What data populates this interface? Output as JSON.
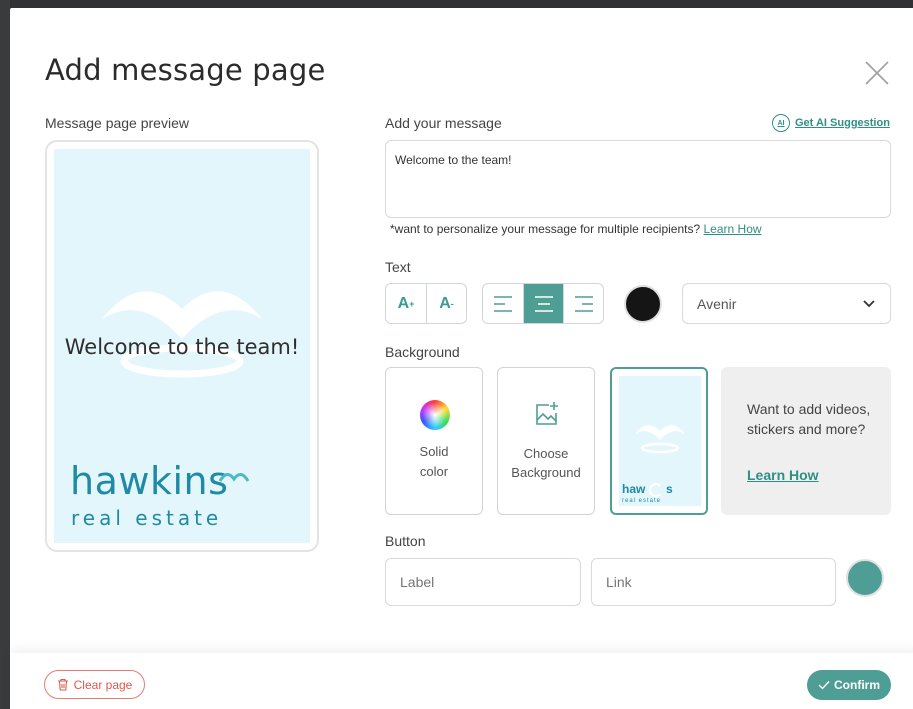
{
  "dialog": {
    "title": "Add message page",
    "close_icon": "close-icon"
  },
  "preview": {
    "label": "Message page preview",
    "message": "Welcome to the team!",
    "background_color": "#e3f6fc",
    "logo_word": "hawkins",
    "logo_sub": "real estate"
  },
  "message": {
    "label": "Add your message",
    "ai_icon": "ai-icon",
    "ai_badge": "AI",
    "ai_link": "Get AI Suggestion",
    "value": "Welcome to the team!",
    "personalize_text": "*want to personalize your message for multiple recipients?",
    "personalize_link": "Learn How"
  },
  "text": {
    "label": "Text",
    "increase_label": "A",
    "decrease_label": "A",
    "increase_sup": "+",
    "decrease_sup": "-",
    "alignments": [
      "align-left-icon",
      "align-center-icon",
      "align-right-icon"
    ],
    "active_alignment": "center",
    "color": "#151515",
    "font": "Avenir"
  },
  "background": {
    "label": "Background",
    "solid_label_1": "Solid",
    "solid_label_2": "color",
    "choose_label_1": "Choose",
    "choose_label_2": "Background",
    "thumb_word": "haw",
    "thumb_word_2": "s",
    "thumb_sub": "real es",
    "thumb_sub_2": "tate",
    "promo_text": "Want to add videos, stickers and more?",
    "promo_link": "Learn How"
  },
  "button": {
    "label": "Button",
    "label_placeholder": "Label",
    "link_placeholder": "Link",
    "color": "#4f9e95"
  },
  "footer": {
    "clear": "Clear page",
    "confirm": "Confirm",
    "accent": "#4f9e95",
    "danger": "#e0584e"
  }
}
